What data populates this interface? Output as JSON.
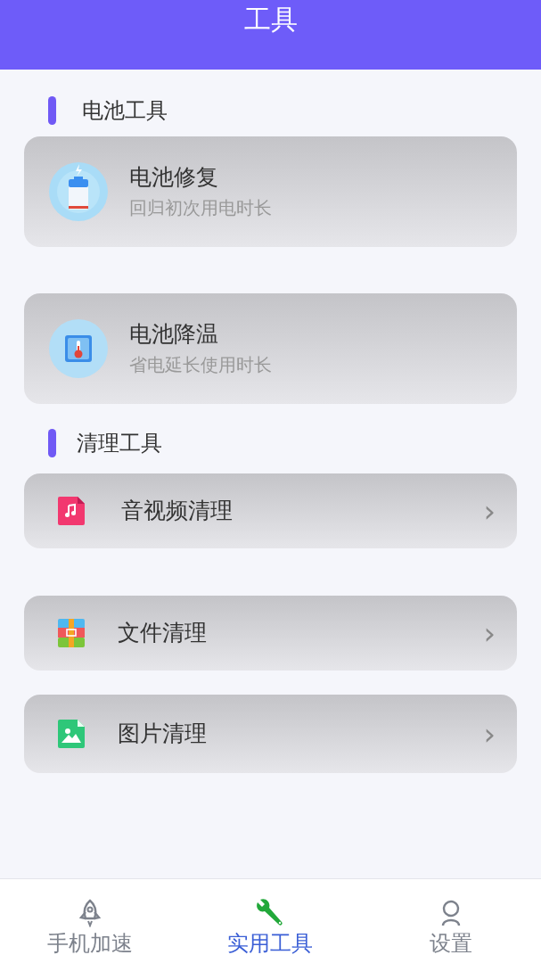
{
  "header": {
    "title": "工具"
  },
  "sections": [
    {
      "title": "电池工具",
      "kind": "large",
      "items": [
        {
          "title": "电池修复",
          "subtitle": "回归初次用电时长"
        },
        {
          "title": "电池降温",
          "subtitle": "省电延长使用时长"
        }
      ]
    },
    {
      "title": "清理工具",
      "kind": "row",
      "items": [
        {
          "title": "音视频清理",
          "chevron": "›"
        },
        {
          "title": "文件清理",
          "chevron": "›"
        },
        {
          "title": "图片清理",
          "chevron": "›"
        }
      ]
    }
  ],
  "tab_bar": [
    {
      "label": "手机加速",
      "selected": false
    },
    {
      "label": "实用工具",
      "selected": true
    },
    {
      "label": "设置",
      "selected": false
    }
  ]
}
